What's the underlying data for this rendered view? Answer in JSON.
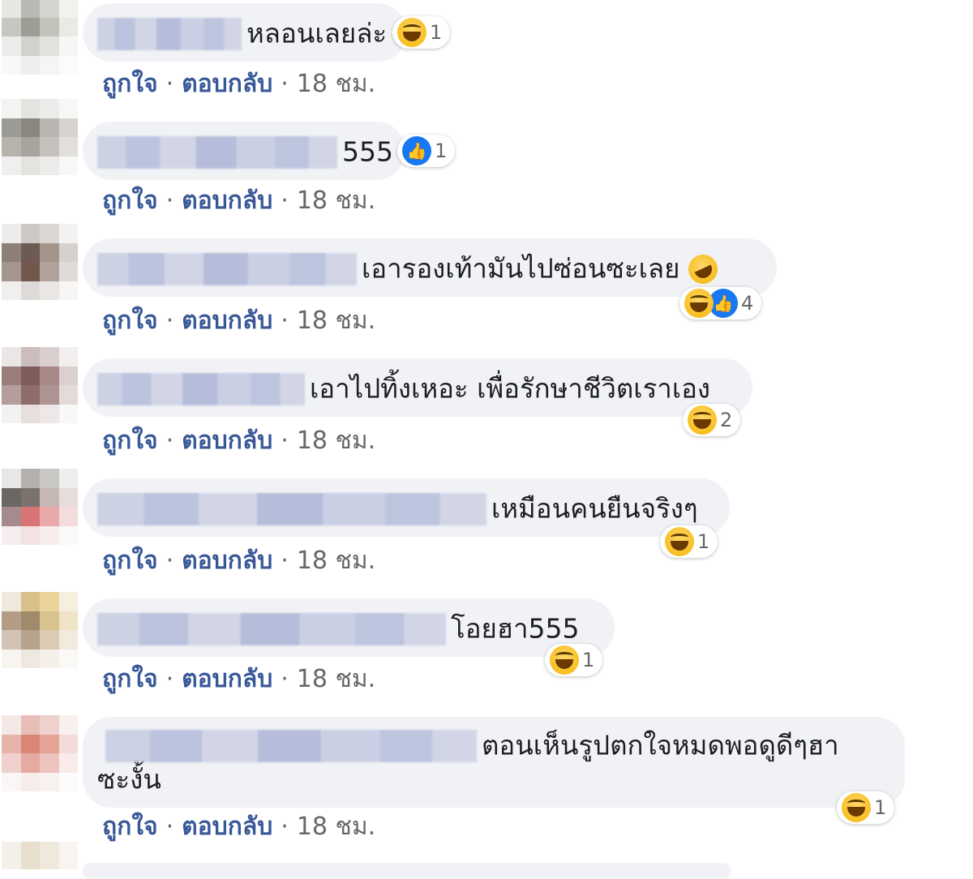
{
  "comments": [
    {
      "text": "หลอนเลยล่ะ",
      "reactions": [
        {
          "type": "haha-icon"
        }
      ],
      "reaction_count": "1",
      "like_label": "ถูกใจ",
      "reply_label": "ตอบกลับ",
      "time": "18 ชม."
    },
    {
      "text": "555",
      "reactions": [
        {
          "type": "like-icon"
        }
      ],
      "reaction_count": "1",
      "like_label": "ถูกใจ",
      "reply_label": "ตอบกลับ",
      "time": "18 ชม."
    },
    {
      "text": "เอารองเท้ามันไปซ่อนซะเลย",
      "reactions": [
        {
          "type": "haha-icon"
        },
        {
          "type": "like-icon"
        }
      ],
      "reaction_count": "4",
      "like_label": "ถูกใจ",
      "reply_label": "ตอบกลับ",
      "time": "18 ชม."
    },
    {
      "text": "เอาไปทิ้งเหอะ เพื่อรักษาชีวิตเราเอง",
      "reactions": [
        {
          "type": "haha-icon"
        }
      ],
      "reaction_count": "2",
      "like_label": "ถูกใจ",
      "reply_label": "ตอบกลับ",
      "time": "18 ชม."
    },
    {
      "text": "เหมือนคนยืนจริงๆ",
      "reactions": [
        {
          "type": "haha-icon"
        }
      ],
      "reaction_count": "1",
      "like_label": "ถูกใจ",
      "reply_label": "ตอบกลับ",
      "time": "18 ชม."
    },
    {
      "text": "โอยฮา555",
      "reactions": [
        {
          "type": "haha-icon"
        }
      ],
      "reaction_count": "1",
      "like_label": "ถูกใจ",
      "reply_label": "ตอบกลับ",
      "time": "18 ชม."
    },
    {
      "text_line1": "ตอนเห็นรูปตกใจหมดพอดูดีๆฮา",
      "text_line2": "ซะงั้น",
      "reactions": [
        {
          "type": "haha-icon"
        }
      ],
      "reaction_count": "1",
      "like_label": "ถูกใจ",
      "reply_label": "ตอบกลับ",
      "time": "18 ชม."
    }
  ],
  "separator": "·",
  "like_icon_glyph": "👍",
  "colors": {
    "bubble": "#f0f2f5",
    "link": "#385898",
    "meta": "#65676b",
    "like_blue": "#1877f2",
    "haha_yellow": "#f5b400"
  }
}
